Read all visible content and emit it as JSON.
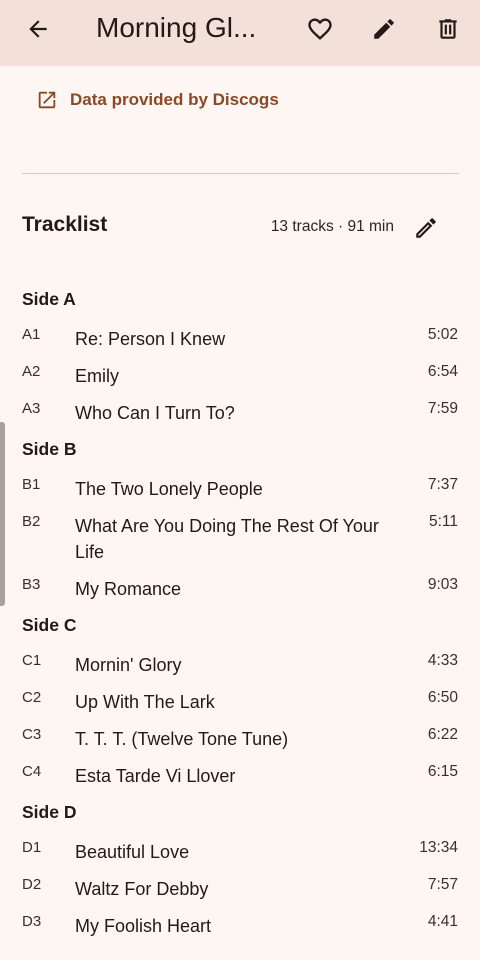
{
  "appbar": {
    "title": "Morning Gl...",
    "icons": [
      "back-arrow-icon",
      "heart-outline-icon",
      "pencil-icon",
      "trash-icon"
    ]
  },
  "discogs_link": {
    "label": "Data provided by Discogs",
    "icon": "open-in-new-icon"
  },
  "tracklist": {
    "title": "Tracklist",
    "summary": "13 tracks · 91 min",
    "sides": [
      {
        "name": "Side A",
        "tracks": [
          {
            "pos": "A1",
            "title": "Re: Person I Knew",
            "duration": "5:02"
          },
          {
            "pos": "A2",
            "title": "Emily",
            "duration": "6:54"
          },
          {
            "pos": "A3",
            "title": "Who Can I Turn To?",
            "duration": "7:59"
          }
        ]
      },
      {
        "name": "Side B",
        "tracks": [
          {
            "pos": "B1",
            "title": "The Two Lonely People",
            "duration": "7:37"
          },
          {
            "pos": "B2",
            "title": "What Are You Doing The Rest Of Your Life",
            "duration": "5:11"
          },
          {
            "pos": "B3",
            "title": "My Romance",
            "duration": "9:03"
          }
        ]
      },
      {
        "name": "Side C",
        "tracks": [
          {
            "pos": "C1",
            "title": "Mornin' Glory",
            "duration": "4:33"
          },
          {
            "pos": "C2",
            "title": "Up With The Lark",
            "duration": "6:50"
          },
          {
            "pos": "C3",
            "title": "T. T. T. (Twelve Tone Tune)",
            "duration": "6:22"
          },
          {
            "pos": "C4",
            "title": "Esta Tarde Vi Llover",
            "duration": "6:15"
          }
        ]
      },
      {
        "name": "Side D",
        "tracks": [
          {
            "pos": "D1",
            "title": "Beautiful Love",
            "duration": "13:34"
          },
          {
            "pos": "D2",
            "title": "Waltz For Debby",
            "duration": "7:57"
          },
          {
            "pos": "D3",
            "title": "My Foolish Heart",
            "duration": "4:41"
          }
        ]
      }
    ]
  },
  "colors": {
    "appbar_bg": "#f2e0d9",
    "page_bg": "#fdf6f3",
    "link": "#8a4a26",
    "text": "#231917"
  }
}
